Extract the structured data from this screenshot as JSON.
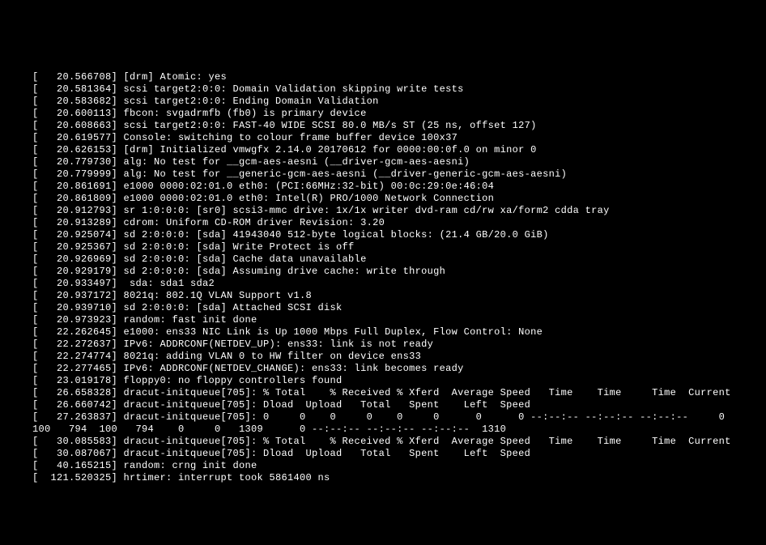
{
  "lines": [
    "[   20.566708] [drm] Atomic: yes",
    "[   20.581364] scsi target2:0:0: Domain Validation skipping write tests",
    "[   20.583682] scsi target2:0:0: Ending Domain Validation",
    "[   20.600113] fbcon: svgadrmfb (fb0) is primary device",
    "[   20.608663] scsi target2:0:0: FAST-40 WIDE SCSI 80.0 MB/s ST (25 ns, offset 127)",
    "[   20.619577] Console: switching to colour frame buffer device 100x37",
    "[   20.626153] [drm] Initialized vmwgfx 2.14.0 20170612 for 0000:00:0f.0 on minor 0",
    "[   20.779730] alg: No test for __gcm-aes-aesni (__driver-gcm-aes-aesni)",
    "[   20.779999] alg: No test for __generic-gcm-aes-aesni (__driver-generic-gcm-aes-aesni)",
    "[   20.861691] e1000 0000:02:01.0 eth0: (PCI:66MHz:32-bit) 00:0c:29:0e:46:04",
    "[   20.861809] e1000 0000:02:01.0 eth0: Intel(R) PRO/1000 Network Connection",
    "[   20.912793] sr 1:0:0:0: [sr0] scsi3-mmc drive: 1x/1x writer dvd-ram cd/rw xa/form2 cdda tray",
    "[   20.913289] cdrom: Uniform CD-ROM driver Revision: 3.20",
    "[   20.925074] sd 2:0:0:0: [sda] 41943040 512-byte logical blocks: (21.4 GB/20.0 GiB)",
    "[   20.925367] sd 2:0:0:0: [sda] Write Protect is off",
    "[   20.926969] sd 2:0:0:0: [sda] Cache data unavailable",
    "[   20.929179] sd 2:0:0:0: [sda] Assuming drive cache: write through",
    "[   20.933497]  sda: sda1 sda2",
    "[   20.937172] 8021q: 802.1Q VLAN Support v1.8",
    "[   20.939710] sd 2:0:0:0: [sda] Attached SCSI disk",
    "[   20.973923] random: fast init done",
    "[   22.262645] e1000: ens33 NIC Link is Up 1000 Mbps Full Duplex, Flow Control: None",
    "[   22.272637] IPv6: ADDRCONF(NETDEV_UP): ens33: link is not ready",
    "[   22.274774] 8021q: adding VLAN 0 to HW filter on device ens33",
    "[   22.277465] IPv6: ADDRCONF(NETDEV_CHANGE): ens33: link becomes ready",
    "[   23.019178] floppy0: no floppy controllers found",
    "[   26.658328] dracut-initqueue[705]: % Total    % Received % Xferd  Average Speed   Time    Time     Time  Current",
    "[   26.660742] dracut-initqueue[705]: Dload  Upload   Total   Spent    Left  Speed",
    "[   27.263837] dracut-initqueue[705]: 0     0    0     0    0     0      0      0 --:--:-- --:--:-- --:--:--     0",
    "100   794  100   794    0     0   1309      0 --:--:-- --:--:-- --:--:--  1310",
    "[   30.085583] dracut-initqueue[705]: % Total    % Received % Xferd  Average Speed   Time    Time     Time  Current",
    "[   30.087067] dracut-initqueue[705]: Dload  Upload   Total   Spent    Left  Speed",
    "[   40.165215] random: crng init done",
    "[  121.520325] hrtimer: interrupt took 5861400 ns"
  ]
}
